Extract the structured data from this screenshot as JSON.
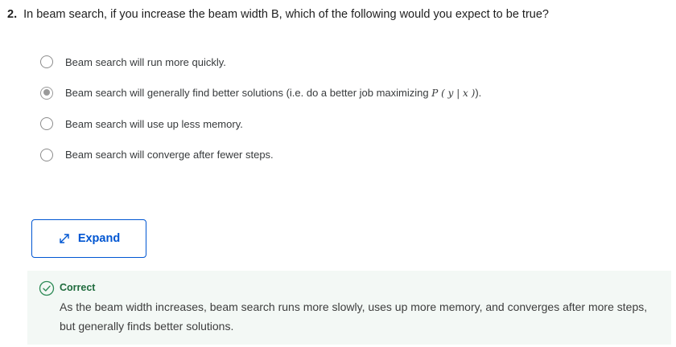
{
  "question": {
    "number": "2.",
    "text": "In beam search, if you increase the beam width B, which of the following would you expect to be true?"
  },
  "options": [
    {
      "label": "Beam search will run more quickly.",
      "selected": false
    },
    {
      "label": "Beam search will generally find better solutions (i.e. do a better job maximizing ",
      "math": "P ( y | x )",
      "suffix": ").",
      "selected": true
    },
    {
      "label": "Beam search will use up less memory.",
      "selected": false
    },
    {
      "label": "Beam search will converge after fewer steps.",
      "selected": false
    }
  ],
  "expand_button": {
    "label": "Expand",
    "icon": "expand-arrows-icon"
  },
  "feedback": {
    "status": "Correct",
    "icon": "check-circle-icon",
    "explanation": "As the beam width increases, beam search runs more slowly, uses up more memory, and converges after more steps, but generally finds better solutions.",
    "colors": {
      "status": "#1f6b3d",
      "background": "#f3f8f5",
      "icon": "#2e8b57"
    }
  },
  "colors": {
    "accent": "#0056d2",
    "radio_selected": "#9a9a9a"
  }
}
